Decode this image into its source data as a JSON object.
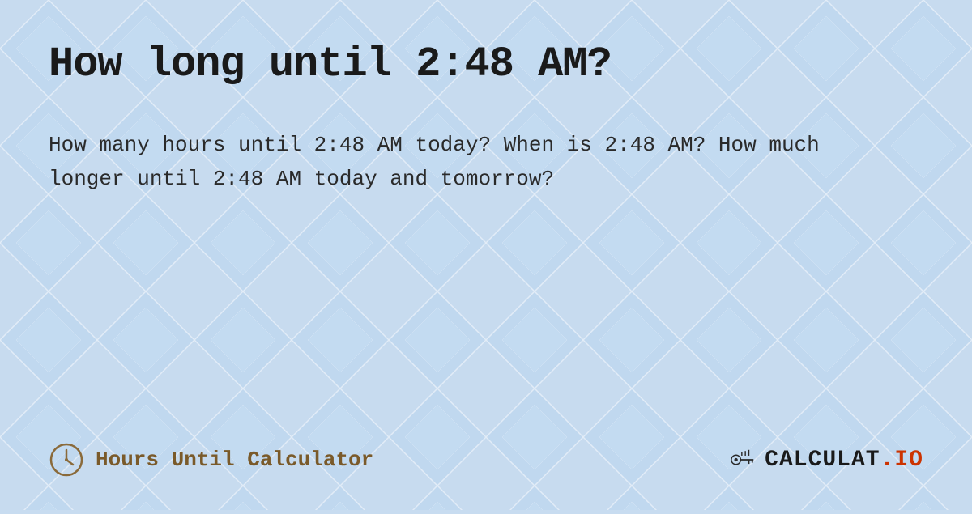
{
  "page": {
    "title": "How long until 2:48 AM?",
    "description": "How many hours until 2:48 AM today? When is 2:48 AM? How much longer until 2:48 AM today and tomorrow?",
    "background_color": "#c8dcf0"
  },
  "footer": {
    "brand_label": "Hours Until Calculator",
    "logo_text": "CALCULAT",
    "logo_tld": ".IO"
  }
}
